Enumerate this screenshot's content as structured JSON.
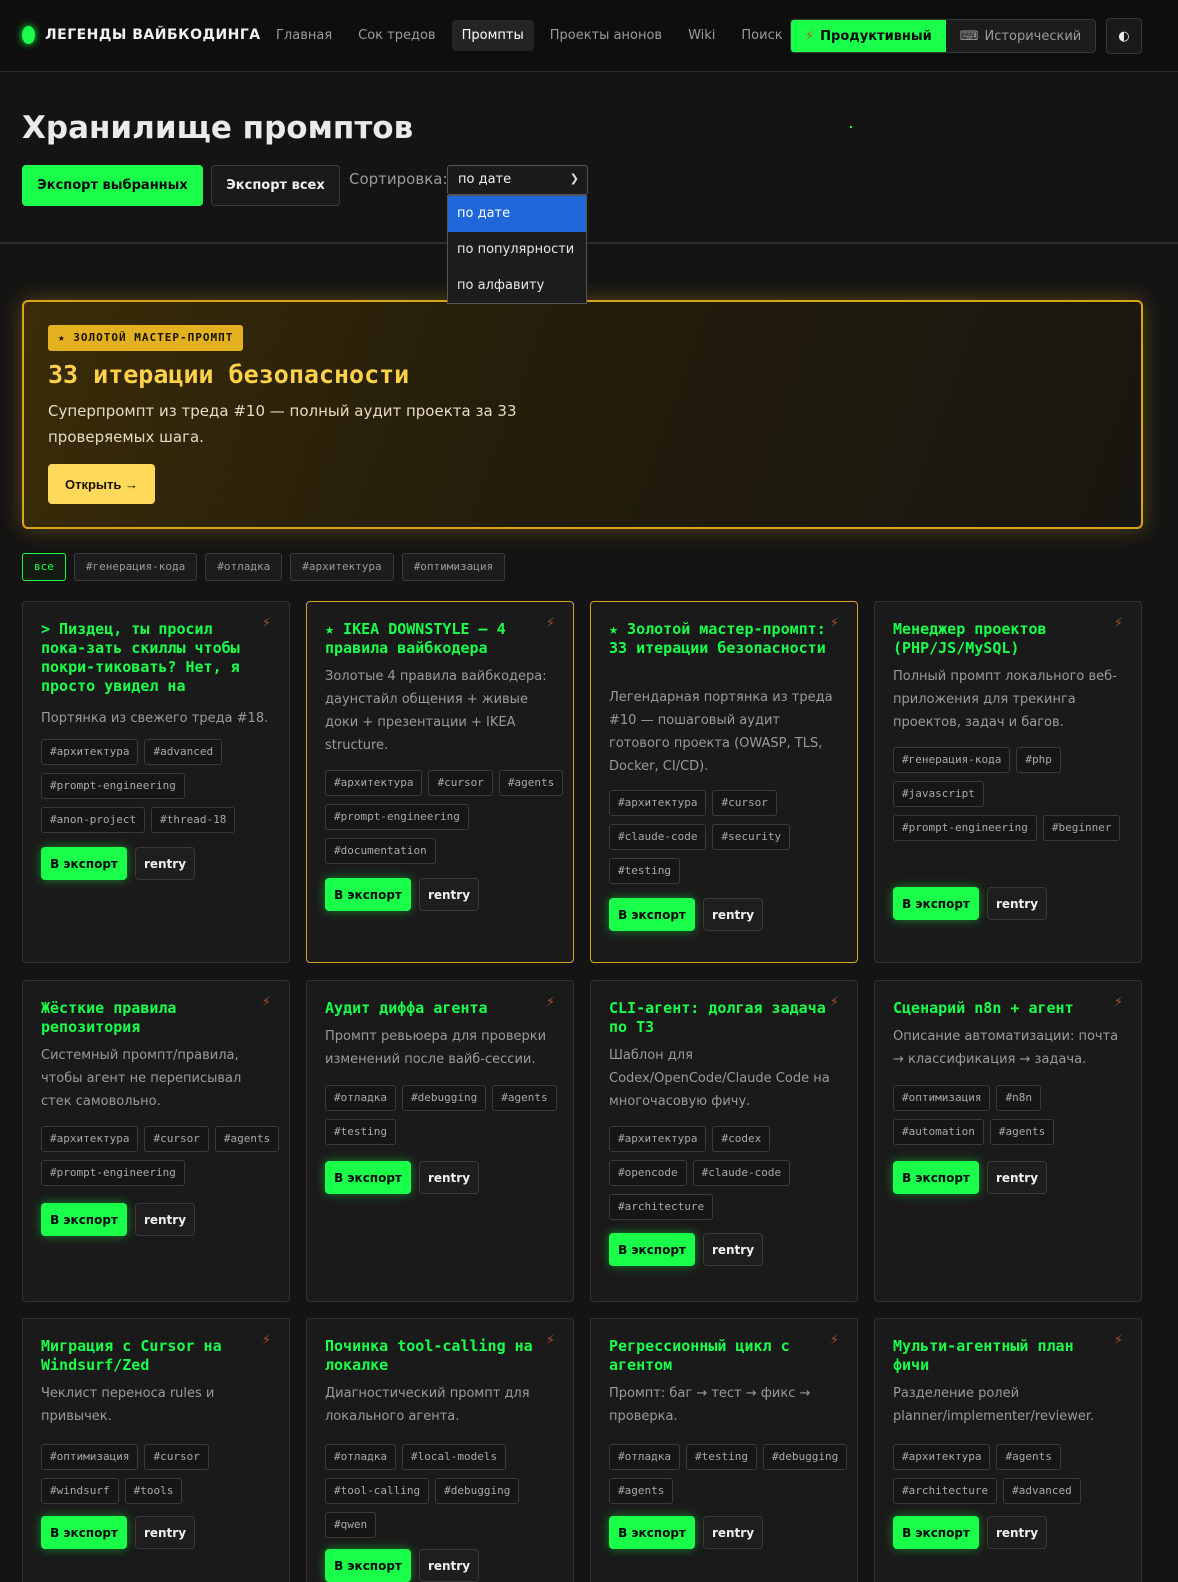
{
  "nav": {
    "brand": "ЛЕГЕНДЫ ВАЙБКОДИНГА",
    "links": [
      "Главная",
      "Сок тредов",
      "Промпты",
      "Проекты анонов",
      "Wiki",
      "Поиск"
    ],
    "active_index": 2,
    "mode_productive": "Продуктивный",
    "mode_historical": "Исторический",
    "theme_toggle": "◐"
  },
  "header": {
    "title": "Хранилище промптов",
    "export_selected": "Экспорт выбранных",
    "export_all": "Экспорт всех",
    "sort_label": "Сортировка:",
    "sort_value": "по дате",
    "sort_options": [
      "по дате",
      "по популярности",
      "по алфавиту"
    ]
  },
  "featured": {
    "badge": "★ ЗОЛОТОЙ МАСТЕР-ПРОМПТ",
    "title": "33 итерации безопасности",
    "description": "Суперпромпт из треда #10 — полный аудит проекта за 33 проверяемых шага.",
    "open_label": "Открыть →"
  },
  "filters": [
    "все",
    "#генерация-кода",
    "#отладка",
    "#архитектура",
    "#оптимизация"
  ],
  "card_labels": {
    "export": "В экспорт",
    "entry": "rentry",
    "bolt": "⚡"
  },
  "cards": [
    {
      "title": "> Пиздец, ты просил пока-зать скиллы чтобы покри-тиковать? Нет, я просто увидел на",
      "desc": "Портянка из свежего треда #18.",
      "tags": [
        "#архитектура",
        "#advanced",
        "#prompt-engineering",
        "#anon-project",
        "#thread-18"
      ]
    },
    {
      "title": "★ IKEA DOWNSTYLE — 4 правила вайбкодера",
      "desc": "Золотые 4 правила вайбкодера: даунстайл общения + живые доки + презентации + IKEA structure.",
      "tags": [
        "#архитектура",
        "#cursor",
        "#agents",
        "#prompt-engineering",
        "#documentation"
      ]
    },
    {
      "title": "★ Золотой мастер-промпт: 33 итерации безопасности",
      "desc": "Легендарная портянка из треда #10 — пошаговый аудит готового проекта (OWASP, TLS, Docker, CI/CD).",
      "tags": [
        "#архитектура",
        "#cursor",
        "#claude-code",
        "#security",
        "#testing"
      ]
    },
    {
      "title": "Менеджер проектов (PHP/JS/MySQL)",
      "desc": "Полный промпт локального веб-приложения для трекинга проектов, задач и багов.",
      "tags": [
        "#генерация-кода",
        "#php",
        "#javascript",
        "#prompt-engineering",
        "#beginner"
      ]
    },
    {
      "title": "Жёсткие правила репозитория",
      "desc": "Системный промпт/правила, чтобы агент не переписывал стек самовольно.",
      "tags": [
        "#архитектура",
        "#cursor",
        "#agents",
        "#prompt-engineering"
      ]
    },
    {
      "title": "Аудит диффа агента",
      "desc": "Промпт ревьюера для проверки изменений после вайб-сессии.",
      "tags": [
        "#отладка",
        "#debugging",
        "#agents",
        "#testing"
      ]
    },
    {
      "title": "CLI-агент: долгая задача по ТЗ",
      "desc": "Шаблон для Codex/OpenCode/Claude Code на многочасовую фичу.",
      "tags": [
        "#архитектура",
        "#codex",
        "#opencode",
        "#claude-code",
        "#architecture"
      ]
    },
    {
      "title": "Сценарий n8n + агент",
      "desc": "Описание автоматизации: почта → классификация → задача.",
      "tags": [
        "#оптимизация",
        "#n8n",
        "#automation",
        "#agents"
      ]
    },
    {
      "title": "Миграция с Cursor на Windsurf/Zed",
      "desc": "Чеклист переноса rules и привычек.",
      "tags": [
        "#оптимизация",
        "#cursor",
        "#windsurf",
        "#tools"
      ]
    },
    {
      "title": "Починка tool-calling на локалке",
      "desc": "Диагностический промпт для локального агента.",
      "tags": [
        "#отладка",
        "#local-models",
        "#tool-calling",
        "#debugging",
        "#qwen"
      ]
    },
    {
      "title": "Регрессионный цикл с агентом",
      "desc": "Промпт: баг → тест → фикс → проверка.",
      "tags": [
        "#отладка",
        "#testing",
        "#debugging",
        "#agents"
      ]
    },
    {
      "title": "Мульти-агентный план фичи",
      "desc": "Разделение ролей planner/implementer/reviewer.",
      "tags": [
        "#архитектура",
        "#agents",
        "#architecture",
        "#advanced"
      ]
    }
  ]
}
